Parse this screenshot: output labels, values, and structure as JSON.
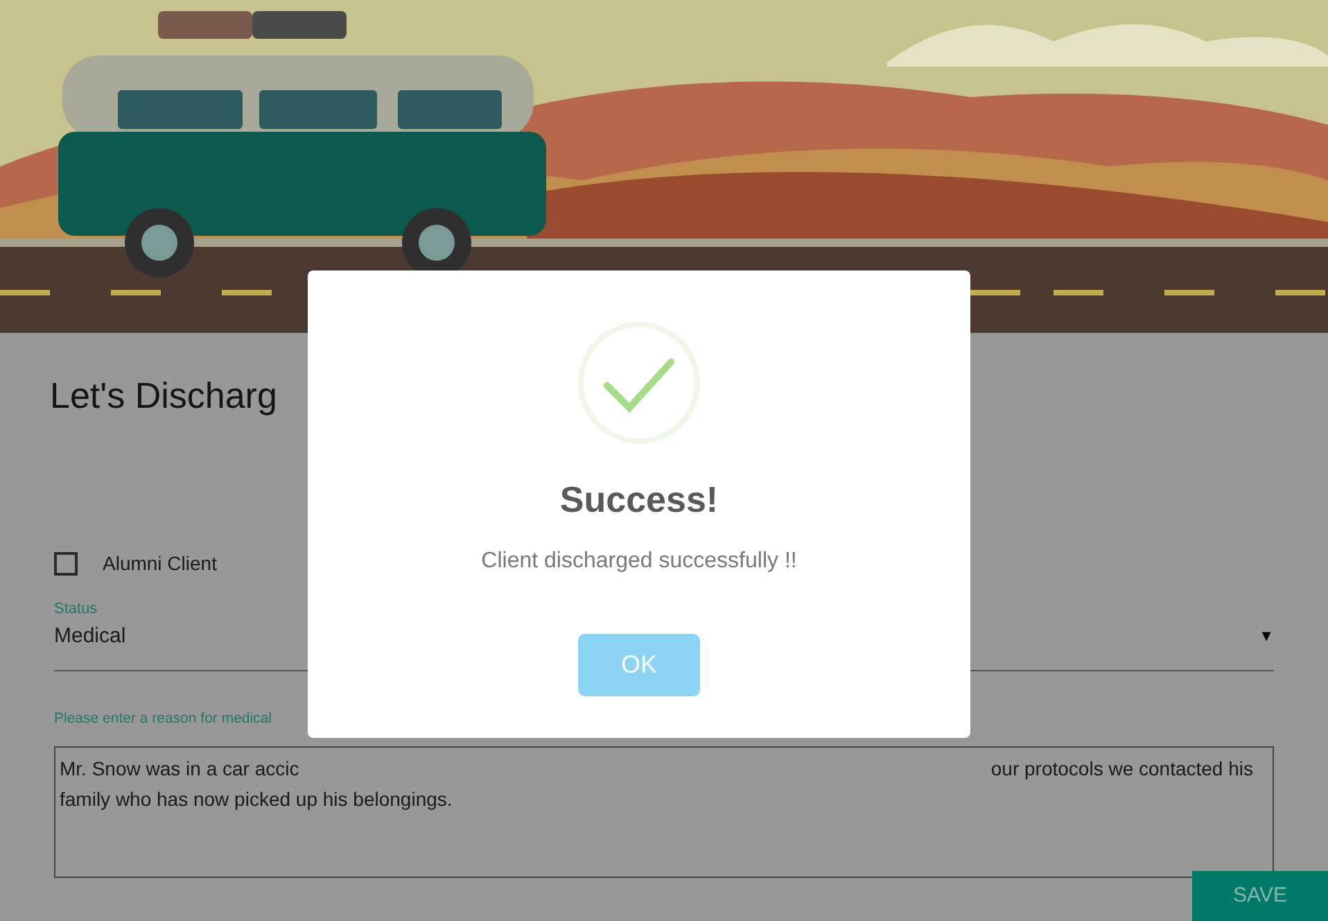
{
  "form": {
    "title": "Let's Discharg",
    "alumni_client": {
      "label": "Alumni Client",
      "checked": false
    },
    "status": {
      "label": "Status",
      "value": "Medical",
      "arrow": "▼"
    },
    "reason": {
      "label": "Please enter a reason for medical",
      "lines": [
        [
          "Mr. Snow was in a car accic",
          "our protocols we contacted his"
        ],
        [
          "family who has now picked up his belongings."
        ]
      ]
    },
    "save_button": "SAVE"
  },
  "dialog": {
    "kind": "success",
    "title": "Success!",
    "message": "Client discharged successfully !!",
    "button": "OK"
  }
}
